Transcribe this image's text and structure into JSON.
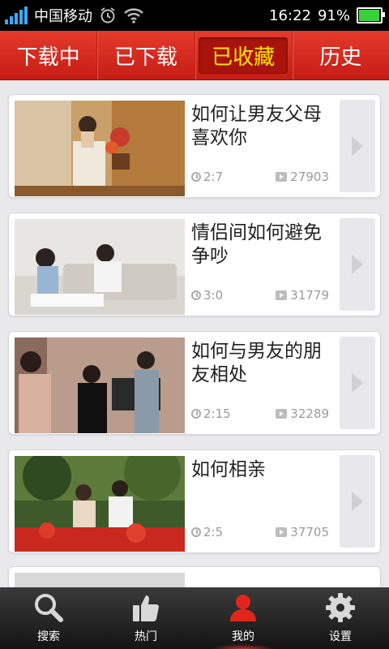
{
  "status_bar": {
    "carrier": "中国移动",
    "time": "16:22",
    "battery_percent": "91%",
    "battery_level": 0.91,
    "icons": [
      "signal-icon",
      "alarm-icon",
      "wifi-icon",
      "battery-icon"
    ]
  },
  "tabs": [
    {
      "label": "下载中",
      "active": false
    },
    {
      "label": "已下载",
      "active": false
    },
    {
      "label": "已收藏",
      "active": true
    },
    {
      "label": "历史",
      "active": false
    }
  ],
  "videos": [
    {
      "title": "如何让男友父母喜欢你",
      "duration": "2:7",
      "plays": "27903"
    },
    {
      "title": "情侣间如何避免争吵",
      "duration": "3:0",
      "plays": "31779"
    },
    {
      "title": "如何与男友的朋友相处",
      "duration": "2:15",
      "plays": "32289"
    },
    {
      "title": "如何相亲",
      "duration": "2:5",
      "plays": "37705"
    }
  ],
  "bottom_nav": [
    {
      "label": "搜索",
      "icon": "search-icon"
    },
    {
      "label": "热门",
      "icon": "thumbs-up-icon"
    },
    {
      "label": "我的",
      "icon": "user-icon",
      "active": true
    },
    {
      "label": "设置",
      "icon": "gear-icon"
    }
  ],
  "colors": {
    "header_red": "#d42a1f",
    "active_tab_text": "#ffe400",
    "active_nav_icon": "#e0261b"
  }
}
